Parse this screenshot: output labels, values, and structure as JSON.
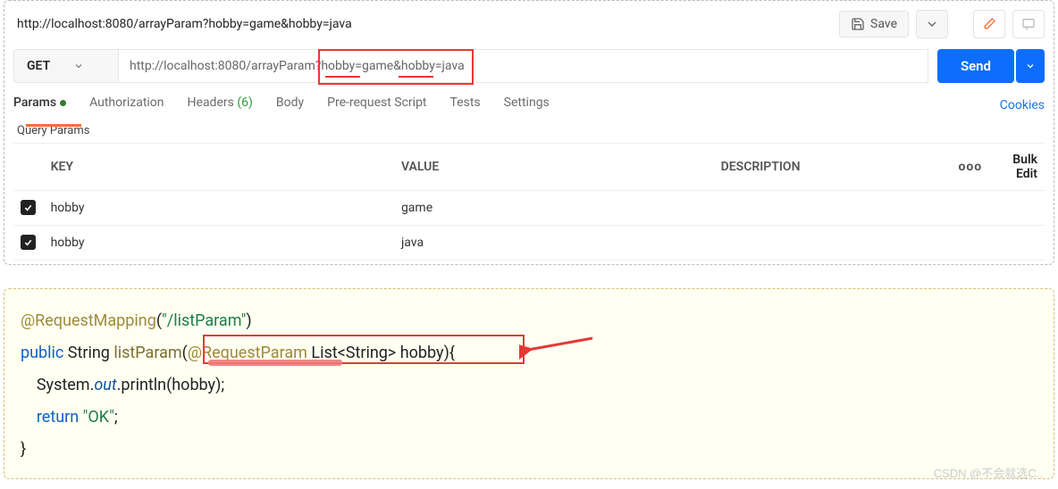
{
  "header": {
    "url_title": "http://localhost:8080/arrayParam?hobby=game&hobby=java",
    "save_label": "Save"
  },
  "request": {
    "method": "GET",
    "url": "http://localhost:8080/arrayParam?hobby=game&hobby=java",
    "send_label": "Send"
  },
  "tabs": {
    "items": [
      {
        "label": "Params",
        "active": true,
        "dot": true
      },
      {
        "label": "Authorization"
      },
      {
        "label": "Headers",
        "count": "(6)"
      },
      {
        "label": "Body"
      },
      {
        "label": "Pre-request Script"
      },
      {
        "label": "Tests"
      },
      {
        "label": "Settings"
      }
    ],
    "cookies_label": "Cookies"
  },
  "params_section": {
    "title": "Query Params",
    "columns": {
      "key": "KEY",
      "value": "VALUE",
      "description": "DESCRIPTION",
      "bulk": "Bulk Edit"
    },
    "rows": [
      {
        "checked": true,
        "key": "hobby",
        "value": "game",
        "description": ""
      },
      {
        "checked": true,
        "key": "hobby",
        "value": "java",
        "description": ""
      }
    ]
  },
  "code": {
    "line1_ann": "@RequestMapping",
    "line1_paren_open": "(",
    "line1_str": "\"/listParam\"",
    "line1_paren_close": ")",
    "line2_kw1": "public",
    "line2_type1": " String ",
    "line2_fn": "listParam",
    "line2_open": "(",
    "line2_ann": "@RequestParam",
    "line2_type2": " List<String> ",
    "line2_arg": "hobby",
    "line2_close": "){",
    "line3_indent": "    ",
    "line3_sys": "System.",
    "line3_out": "out",
    "line3_call": ".println(hobby);",
    "line4_indent": "    ",
    "line4_kw": "return ",
    "line4_str": "\"OK\"",
    "line4_semi": ";",
    "line5": "}"
  },
  "watermark": "CSDN @不会就选C.."
}
